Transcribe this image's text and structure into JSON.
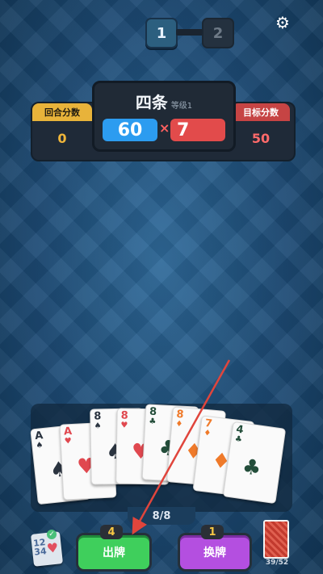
{
  "stages": [
    "1",
    "2"
  ],
  "settings_icon": "gear-icon",
  "hand": {
    "name": "四条",
    "level": "等级1",
    "chips": "60",
    "times": "×",
    "mult": "7"
  },
  "round_score": {
    "label": "回合分数",
    "value": "0"
  },
  "target_score": {
    "label": "目标分数",
    "value": "50"
  },
  "cards": [
    {
      "rank": "A",
      "suit": "♠",
      "color": "blk"
    },
    {
      "rank": "A",
      "suit": "♥",
      "color": "red"
    },
    {
      "rank": "8",
      "suit": "♠",
      "color": "blk"
    },
    {
      "rank": "8",
      "suit": "♥",
      "color": "red"
    },
    {
      "rank": "8",
      "suit": "♣",
      "color": "grn"
    },
    {
      "rank": "8",
      "suit": "♦",
      "color": "org"
    },
    {
      "rank": "7",
      "suit": "♦",
      "color": "org"
    },
    {
      "rank": "4",
      "suit": "♣",
      "color": "grn"
    }
  ],
  "hand_count": "8/8",
  "play": {
    "label": "出牌",
    "remaining": "4"
  },
  "discard": {
    "label": "换牌",
    "remaining": "1"
  },
  "sort_icon": {
    "numbers": "12\n34"
  },
  "deck": {
    "count": "39/52"
  }
}
